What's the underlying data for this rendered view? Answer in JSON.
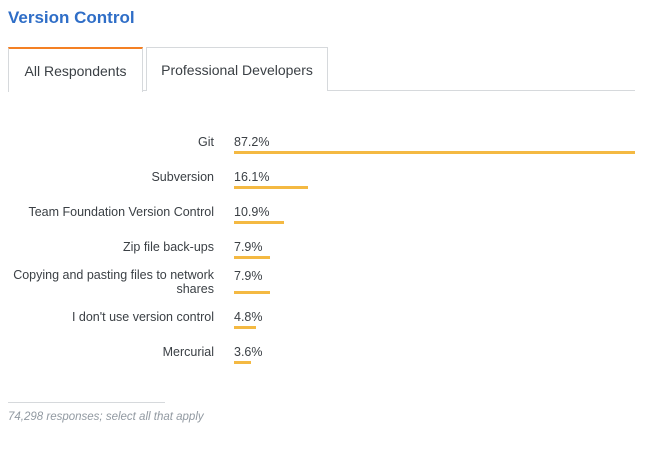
{
  "title": "Version Control",
  "tabs": [
    {
      "label": "All Respondents",
      "active": true
    },
    {
      "label": "Professional Developers",
      "active": false
    }
  ],
  "bar_color": "#f4b942",
  "accent_color": "#f48024",
  "chart_data": {
    "type": "bar",
    "orientation": "horizontal",
    "categories": [
      "Git",
      "Subversion",
      "Team Foundation Version Control",
      "Zip file back-ups",
      "Copying and pasting files to network shares",
      "I don't use version control",
      "Mercurial"
    ],
    "values": [
      87.2,
      16.1,
      10.9,
      7.9,
      7.9,
      4.8,
      3.6
    ],
    "value_labels": [
      "87.2%",
      "16.1%",
      "10.9%",
      "7.9%",
      "7.9%",
      "4.8%",
      "3.6%"
    ],
    "xlim": [
      0,
      87.2
    ]
  },
  "footnote": "74,298 responses; select all that apply"
}
